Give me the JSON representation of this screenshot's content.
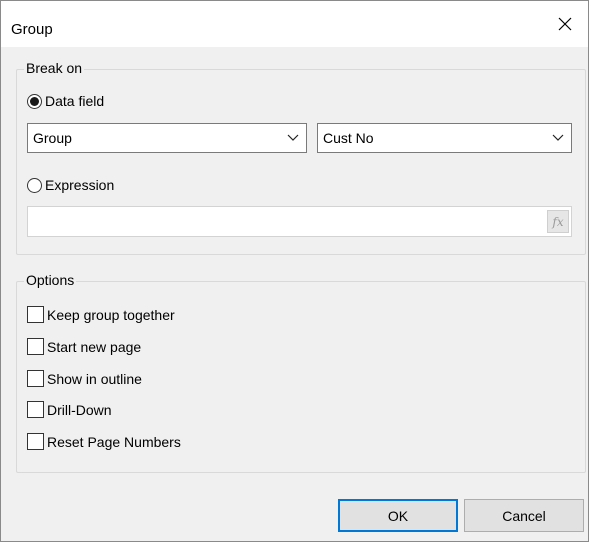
{
  "window": {
    "title": "Group",
    "close_icon": "close-icon"
  },
  "break_on": {
    "label": "Break on",
    "data_field_label": "Data field",
    "data_field_selected": true,
    "field_combo_1_value": "Group",
    "field_combo_2_value": "Cust No",
    "expression_label": "Expression",
    "expression_selected": false,
    "expression_value": "",
    "fx_button_label": "fx"
  },
  "options": {
    "label": "Options",
    "items": [
      {
        "label": "Keep group together",
        "checked": false
      },
      {
        "label": "Start new page",
        "checked": false
      },
      {
        "label": "Show in outline",
        "checked": false
      },
      {
        "label": "Drill-Down",
        "checked": false
      },
      {
        "label": "Reset Page Numbers",
        "checked": false
      }
    ]
  },
  "buttons": {
    "ok": "OK",
    "cancel": "Cancel"
  },
  "colors": {
    "dialog_bg": "#f0f0f0",
    "default_button_border": "#0078d7"
  }
}
